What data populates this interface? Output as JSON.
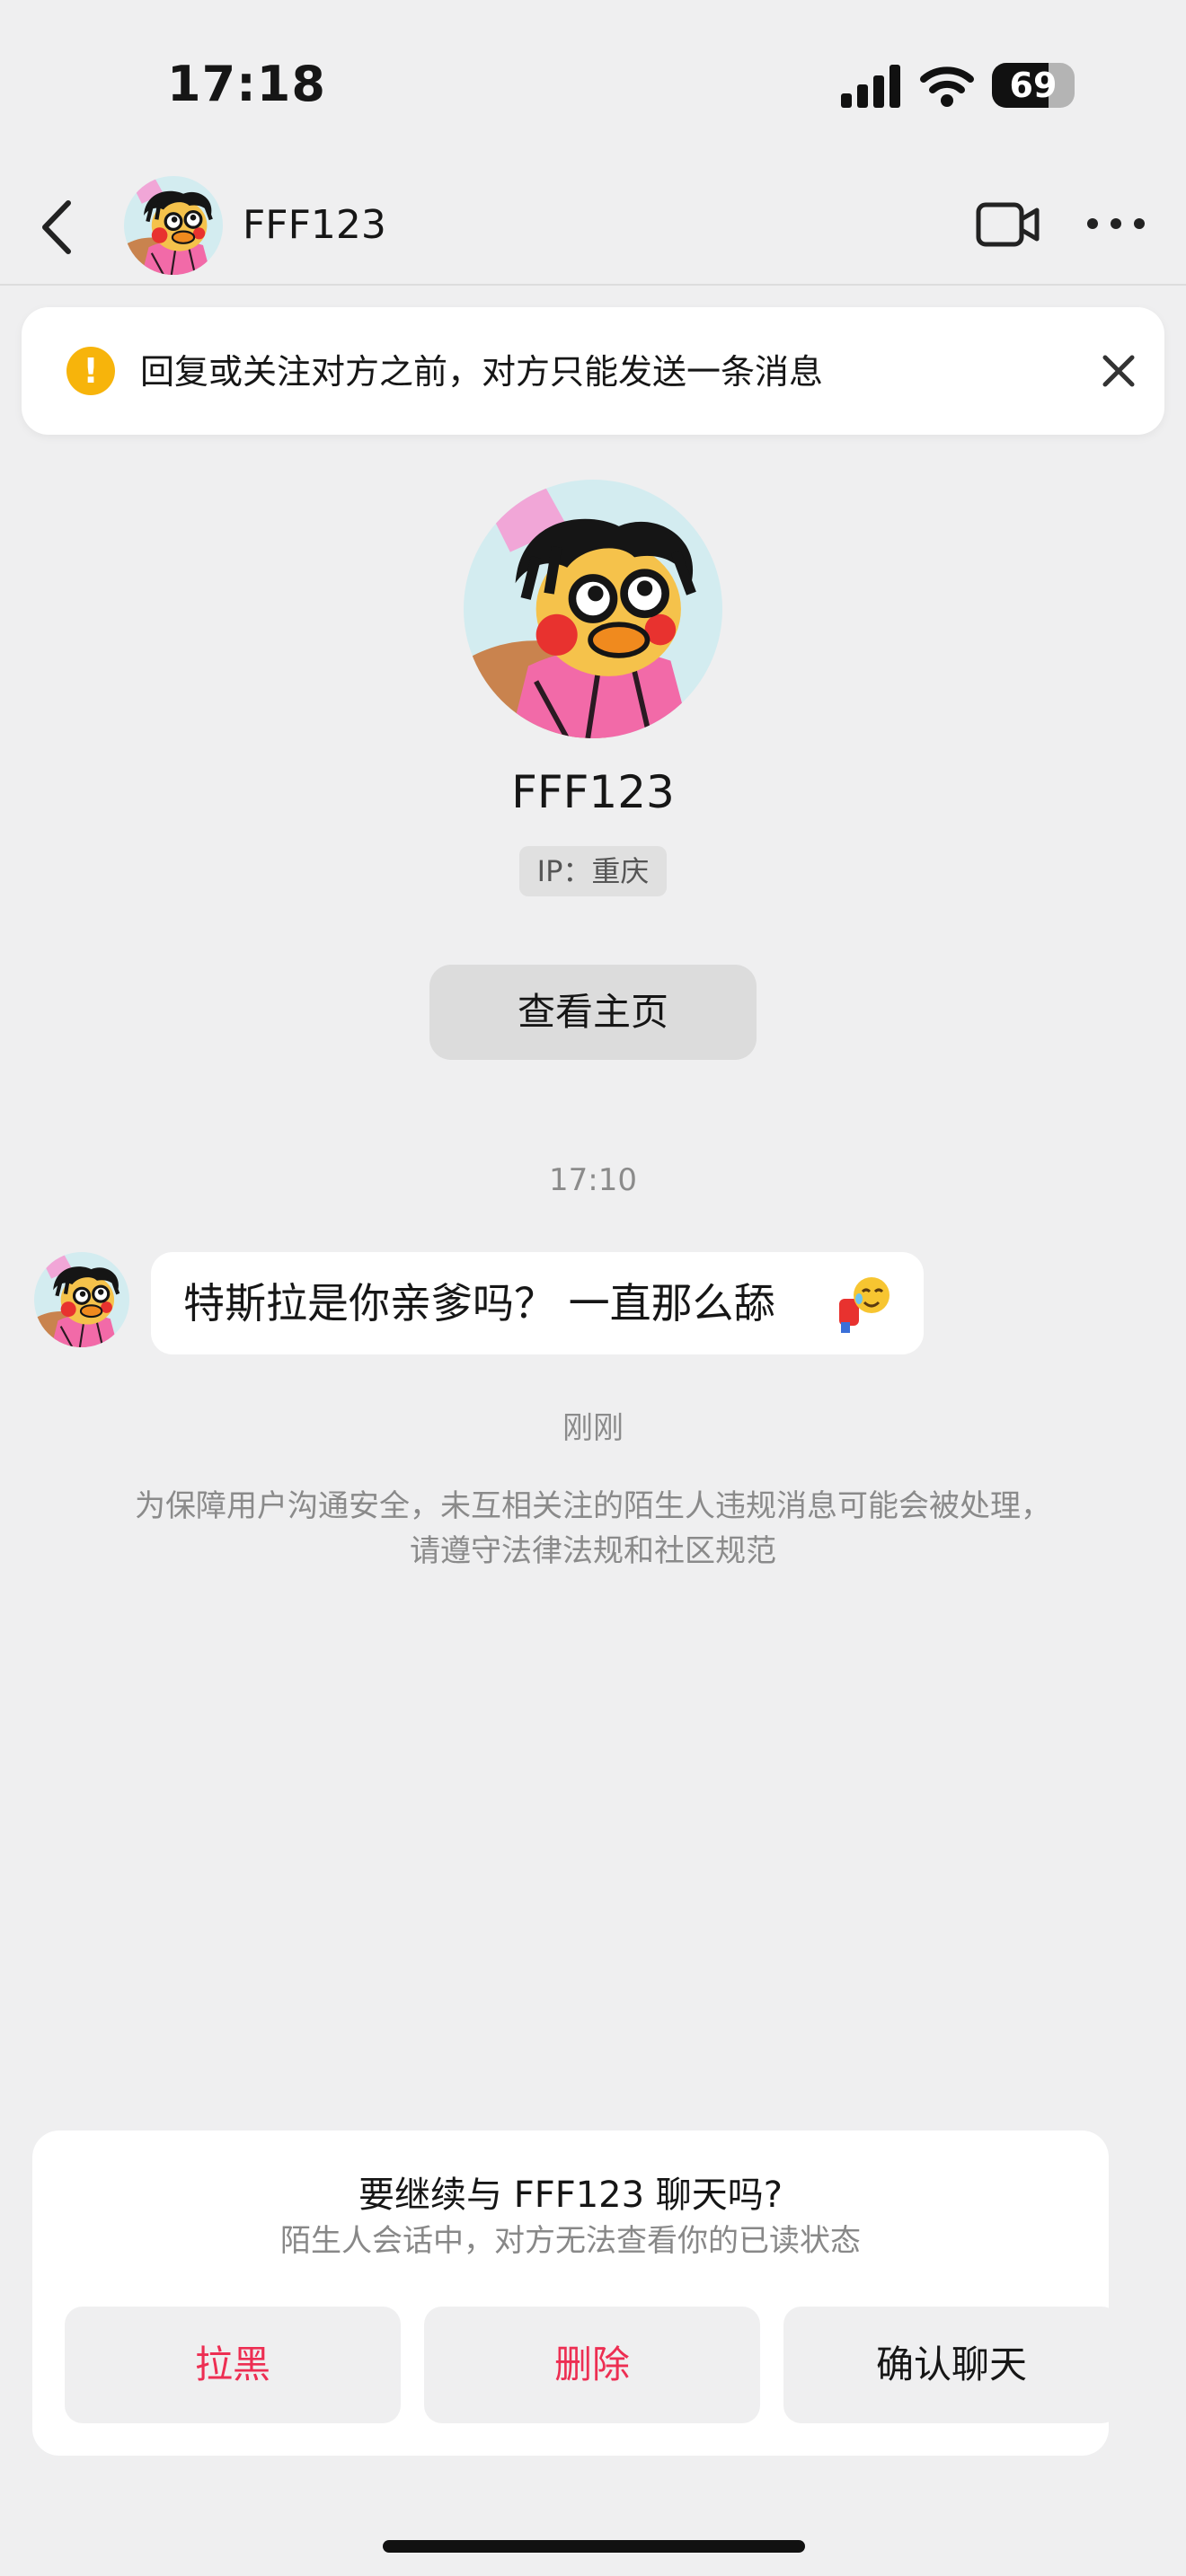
{
  "status_bar": {
    "time": "17:18",
    "battery_level": "69"
  },
  "header": {
    "contact_name": "FFF123"
  },
  "notice": {
    "text": "回复或关注对方之前，对方只能发送一条消息"
  },
  "profile": {
    "name": "FFF123",
    "ip_label": "IP：重庆",
    "view_home_button": "查看主页"
  },
  "chat": {
    "time_1": "17:10",
    "message": "特斯拉是你亲爹吗？ 一直那么舔",
    "time_2": "刚刚",
    "policy_notice": "为保障用户沟通安全，未互相关注的陌生人违规消息可能会被处理，请遵守法律法规和社区规范"
  },
  "confirm_card": {
    "title": "要继续与 FFF123 聊天吗?",
    "subtitle": "陌生人会话中，对方无法查看你的已读状态",
    "block_button": "拉黑",
    "delete_button": "删除",
    "confirm_button": "确认聊天"
  },
  "colors": {
    "background": "#efeff0",
    "accent_red": "#ed2e52",
    "warning_yellow": "#f7b40b"
  },
  "icons": [
    "back-icon",
    "video-call-icon",
    "more-icon",
    "warning-icon",
    "close-icon",
    "signal-icon",
    "wifi-icon",
    "battery-icon"
  ]
}
